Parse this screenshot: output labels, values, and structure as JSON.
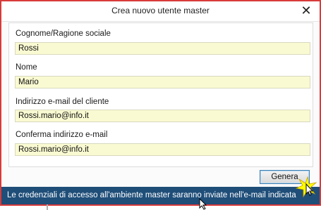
{
  "dialog": {
    "title": "Crea nuovo utente master",
    "close_symbol": "✕"
  },
  "form": {
    "fields": [
      {
        "label": "Cognome/Ragione sociale",
        "value": "Rossi"
      },
      {
        "label": "Nome",
        "value": "Mario"
      },
      {
        "label": "Indirizzo e-mail del cliente",
        "value": "Rossi.mario@info.it"
      },
      {
        "label": "Conferma indirizzo e-mail",
        "value": "Rossi.mario@info.it"
      }
    ]
  },
  "actions": {
    "generate_label": "Genera"
  },
  "status": {
    "message": "Le credenziali di accesso all'ambiente master saranno inviate nell'e-mail indicata"
  },
  "colors": {
    "dialog_border": "#d83a3a",
    "field_background": "#fafad2",
    "status_background": "#1f4e79",
    "highlight": "#ffff00"
  },
  "icons": {
    "close": "close-icon",
    "highlight": "click-highlight-icon",
    "cursor": "mouse-pointer-icon"
  }
}
